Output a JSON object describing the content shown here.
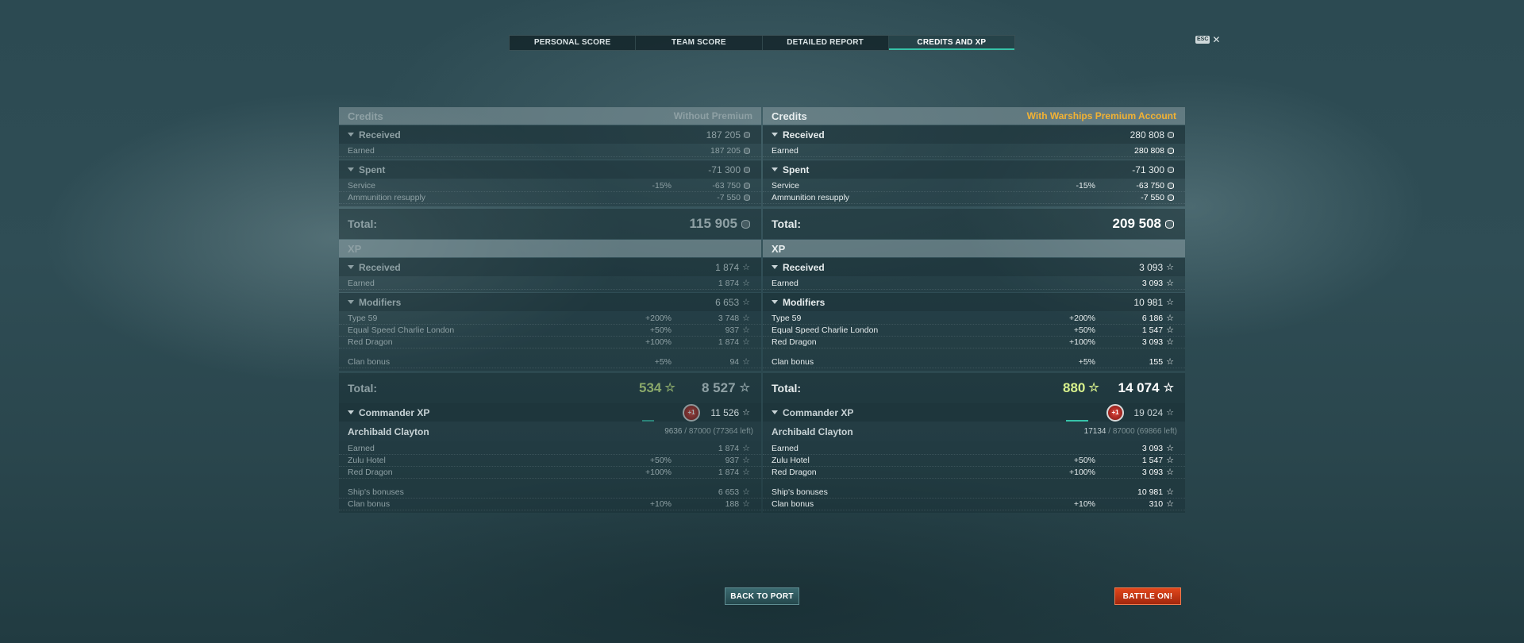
{
  "tabs": [
    {
      "label": "PERSONAL SCORE"
    },
    {
      "label": "TEAM SCORE"
    },
    {
      "label": "DETAILED REPORT"
    },
    {
      "label": "CREDITS AND XP",
      "active": true
    }
  ],
  "close": {
    "key": "ESC",
    "symbol": "✕"
  },
  "left": {
    "credits_title": "Credits",
    "credits_subtitle": "Without Premium",
    "received": {
      "label": "Received",
      "value": "187 205"
    },
    "earned": {
      "label": "Earned",
      "value": "187 205"
    },
    "spent": {
      "label": "Spent",
      "value": "-71 300"
    },
    "service": {
      "label": "Service",
      "pct": "-15%",
      "value": "-63 750"
    },
    "ammo": {
      "label": "Ammunition resupply",
      "value": "-7 550"
    },
    "credits_total": {
      "label": "Total:",
      "value": "115 905"
    },
    "xp_title": "XP",
    "xp_received": {
      "label": "Received",
      "value": "1 874"
    },
    "xp_earned": {
      "label": "Earned",
      "value": "1 874"
    },
    "modifiers": {
      "label": "Modifiers",
      "value": "6 653"
    },
    "mod_rows": [
      {
        "label": "Type 59",
        "pct": "+200%",
        "value": "3 748"
      },
      {
        "label": "Equal Speed Charlie London",
        "pct": "+50%",
        "value": "937"
      },
      {
        "label": "Red Dragon",
        "pct": "+100%",
        "value": "1 874"
      }
    ],
    "clan_bonus": {
      "label": "Clan bonus",
      "pct": "+5%",
      "value": "94"
    },
    "xp_total": {
      "label": "Total:",
      "bonus": "534",
      "value": "8 527"
    },
    "commander": {
      "label": "Commander XP",
      "badge": "+1",
      "value": "11 526"
    },
    "captain": {
      "name": "Archibald Clayton",
      "current": "9636",
      "rest": " / 87000 (77364 left)",
      "progress": 0.11
    },
    "cmdr_rows": [
      {
        "label": "Earned",
        "pct": "",
        "value": "1 874"
      },
      {
        "label": "Zulu Hotel",
        "pct": "+50%",
        "value": "937"
      },
      {
        "label": "Red Dragon",
        "pct": "+100%",
        "value": "1 874"
      }
    ],
    "cmdr_rows2": [
      {
        "label": "Ship's bonuses",
        "pct": "",
        "value": "6 653"
      },
      {
        "label": "Clan bonus",
        "pct": "+10%",
        "value": "188"
      }
    ]
  },
  "right": {
    "credits_title": "Credits",
    "credits_subtitle": "With Warships Premium Account",
    "received": {
      "label": "Received",
      "value": "280 808"
    },
    "earned": {
      "label": "Earned",
      "value": "280 808"
    },
    "spent": {
      "label": "Spent",
      "value": "-71 300"
    },
    "service": {
      "label": "Service",
      "pct": "-15%",
      "value": "-63 750"
    },
    "ammo": {
      "label": "Ammunition resupply",
      "value": "-7 550"
    },
    "credits_total": {
      "label": "Total:",
      "value": "209 508"
    },
    "xp_title": "XP",
    "xp_received": {
      "label": "Received",
      "value": "3 093"
    },
    "xp_earned": {
      "label": "Earned",
      "value": "3 093"
    },
    "modifiers": {
      "label": "Modifiers",
      "value": "10 981"
    },
    "mod_rows": [
      {
        "label": "Type 59",
        "pct": "+200%",
        "value": "6 186"
      },
      {
        "label": "Equal Speed Charlie London",
        "pct": "+50%",
        "value": "1 547"
      },
      {
        "label": "Red Dragon",
        "pct": "+100%",
        "value": "3 093"
      }
    ],
    "clan_bonus": {
      "label": "Clan bonus",
      "pct": "+5%",
      "value": "155"
    },
    "xp_total": {
      "label": "Total:",
      "bonus": "880",
      "value": "14 074"
    },
    "commander": {
      "label": "Commander XP",
      "badge": "+1",
      "value": "19 024"
    },
    "captain": {
      "name": "Archibald Clayton",
      "current": "17134",
      "rest": " / 87000 (69866 left)",
      "progress": 0.2
    },
    "cmdr_rows": [
      {
        "label": "Earned",
        "pct": "",
        "value": "3 093"
      },
      {
        "label": "Zulu Hotel",
        "pct": "+50%",
        "value": "1 547"
      },
      {
        "label": "Red Dragon",
        "pct": "+100%",
        "value": "3 093"
      }
    ],
    "cmdr_rows2": [
      {
        "label": "Ship's bonuses",
        "pct": "",
        "value": "10 981"
      },
      {
        "label": "Clan bonus",
        "pct": "+10%",
        "value": "310"
      }
    ]
  },
  "buttons": {
    "back": "BACK TO PORT",
    "battle": "BATTLE ON!"
  },
  "colors": {
    "accent": "#36c3a9",
    "premium": "#f3b233",
    "battle": "#d33a15"
  }
}
